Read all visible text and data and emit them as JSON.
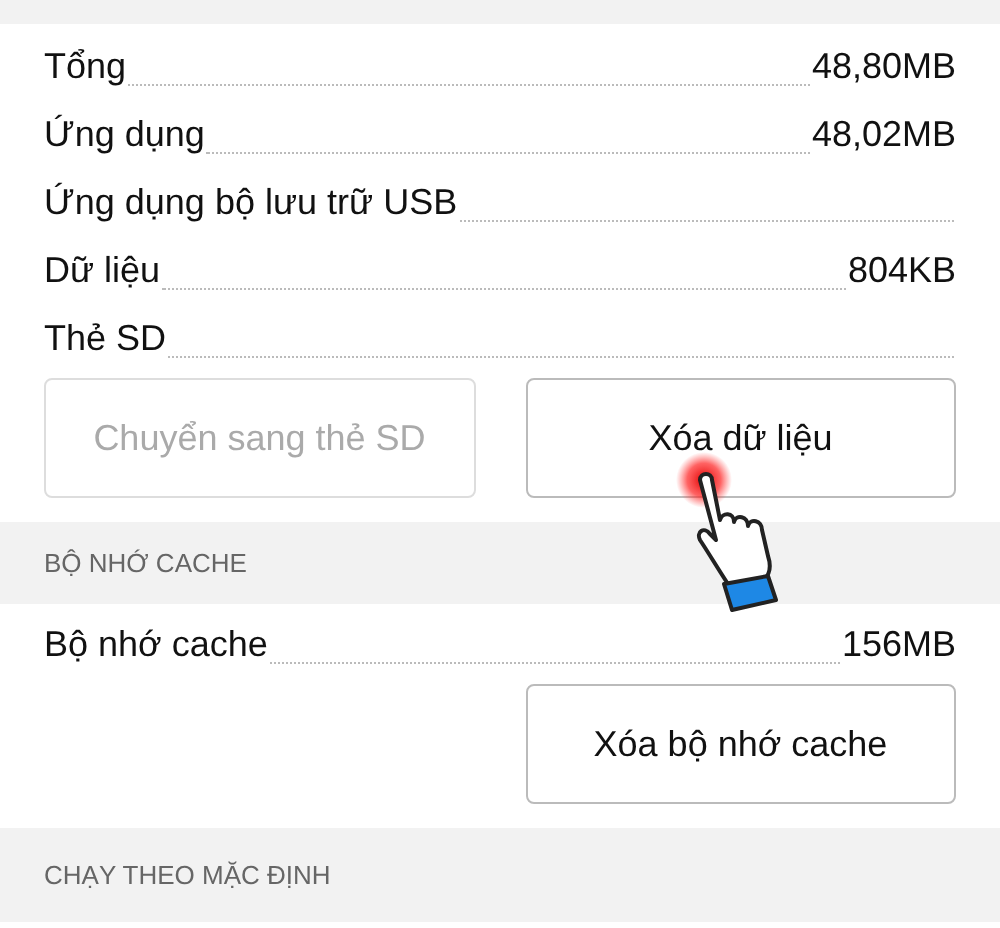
{
  "storage": {
    "rows": [
      {
        "label": "Tổng",
        "value": "48,80MB"
      },
      {
        "label": "Ứng dụng",
        "value": "48,02MB"
      },
      {
        "label": "Ứng dụng bộ lưu trữ USB"
      },
      {
        "label": "Dữ liệu",
        "value": "804KB"
      },
      {
        "label": "Thẻ SD"
      }
    ],
    "buttons": [
      {
        "label": "Chuyển sang thẻ SD",
        "disabled": true
      },
      {
        "label": "Xóa dữ liệu",
        "disabled": false
      }
    ]
  },
  "cache": {
    "header": "BỘ NHỚ CACHE",
    "rows": [
      {
        "label": "Bộ nhớ cache",
        "value": "156MB"
      }
    ],
    "buttons": [
      {
        "label": "Xóa bộ nhớ cache",
        "disabled": false
      }
    ]
  },
  "defaults": {
    "header": "CHẠY THEO MẶC ĐỊNH"
  }
}
